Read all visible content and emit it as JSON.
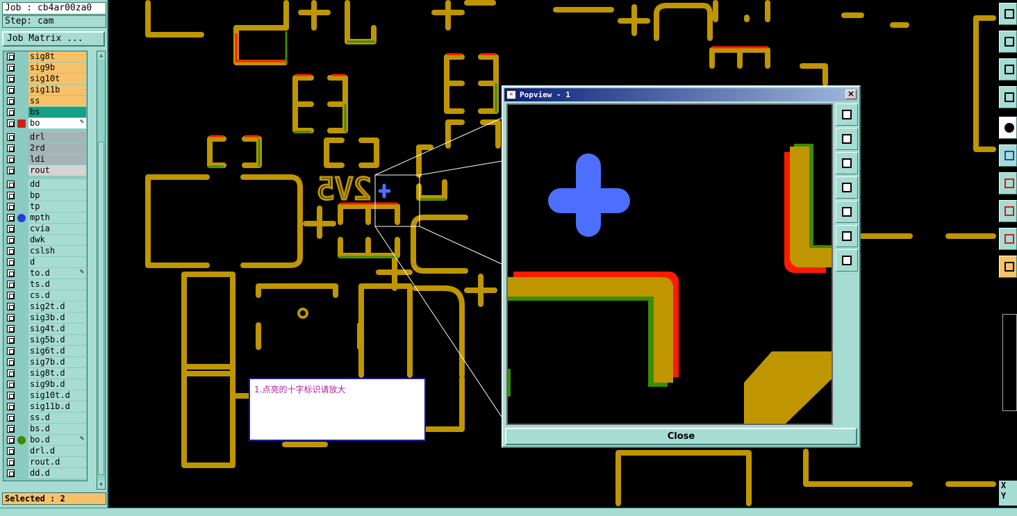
{
  "job_label": "Job : cb4ar00za0",
  "step_label": "Step: cam",
  "job_matrix_button": "Job Matrix ...",
  "selected_label": "Selected : 2",
  "layers": [
    {
      "name": "sig8t",
      "color": "#f7c267"
    },
    {
      "name": "sig9b",
      "color": "#f7c267"
    },
    {
      "name": "sig10t",
      "color": "#f7c267"
    },
    {
      "name": "sig11b",
      "color": "#f7c267"
    },
    {
      "name": "ss",
      "color": "#f7c267"
    },
    {
      "name": "bs",
      "color": "#13a085"
    },
    {
      "name": "bo",
      "color": "#ffffff"
    },
    {
      "name": "drl",
      "color": "#a6b4b8"
    },
    {
      "name": "2rd",
      "color": "#a6b4b8"
    },
    {
      "name": "ldi",
      "color": "#a6b4b8"
    },
    {
      "name": "rout",
      "color": "#d4d4d4"
    },
    {
      "name": "dd",
      "color": "#a7dcd2"
    },
    {
      "name": "bp",
      "color": "#a7dcd2"
    },
    {
      "name": "tp",
      "color": "#a7dcd2"
    },
    {
      "name": "mpth",
      "color": "#a7dcd2"
    },
    {
      "name": "cvia",
      "color": "#a7dcd2"
    },
    {
      "name": "dwk",
      "color": "#a7dcd2"
    },
    {
      "name": "cslsh",
      "color": "#a7dcd2"
    },
    {
      "name": "d",
      "color": "#a7dcd2"
    },
    {
      "name": "to.d",
      "color": "#a7dcd2"
    },
    {
      "name": "ts.d",
      "color": "#a7dcd2"
    },
    {
      "name": "cs.d",
      "color": "#a7dcd2"
    },
    {
      "name": "sig2t.d",
      "color": "#a7dcd2"
    },
    {
      "name": "sig3b.d",
      "color": "#a7dcd2"
    },
    {
      "name": "sig4t.d",
      "color": "#a7dcd2"
    },
    {
      "name": "sig5b.d",
      "color": "#a7dcd2"
    },
    {
      "name": "sig6t.d",
      "color": "#a7dcd2"
    },
    {
      "name": "sig7b.d",
      "color": "#a7dcd2"
    },
    {
      "name": "sig8t.d",
      "color": "#a7dcd2"
    },
    {
      "name": "sig9b.d",
      "color": "#a7dcd2"
    },
    {
      "name": "sig10t.d",
      "color": "#a7dcd2"
    },
    {
      "name": "sig11b.d",
      "color": "#a7dcd2"
    },
    {
      "name": "ss.d",
      "color": "#a7dcd2"
    },
    {
      "name": "bs.d",
      "color": "#a7dcd2"
    },
    {
      "name": "bo.d",
      "color": "#a7dcd2"
    },
    {
      "name": "drl.d",
      "color": "#a7dcd2"
    },
    {
      "name": "rout.d",
      "color": "#a7dcd2"
    },
    {
      "name": "dd.d",
      "color": "#a7dcd2"
    }
  ],
  "board_text": "2V5",
  "note_text": "1.点亮的十字标识请放大",
  "popup": {
    "title": "Popview - 1",
    "close_label": "Close"
  },
  "coords": {
    "x_label": "X",
    "y_label": "Y"
  },
  "colors": {
    "trace": "#bf9600",
    "highlight": "#4d6fff",
    "red": "#ff1a00",
    "green": "#3a8c00",
    "panel": "#a7dcd2"
  }
}
